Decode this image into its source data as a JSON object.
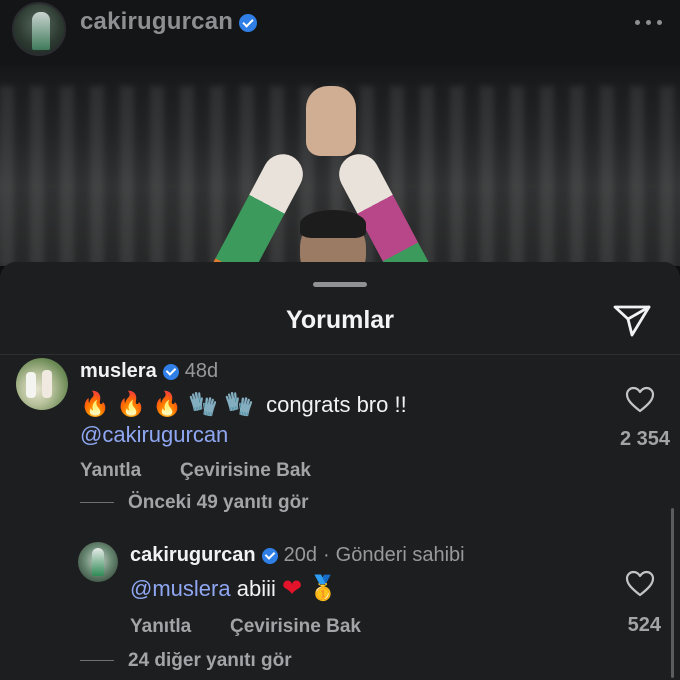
{
  "header": {
    "username": "cakirugurcan",
    "verified": true,
    "more_icon": "more-horizontal-icon"
  },
  "sheet": {
    "title": "Yorumlar",
    "share_icon": "send-icon"
  },
  "comments": [
    {
      "username": "muslera",
      "verified": true,
      "age": "48d",
      "text_emojis": "🔥 🔥 🔥 🧤 🧤",
      "text": "congrats bro !!",
      "mention": "@cakirugurcan",
      "reply_label": "Yanıtla",
      "translate_label": "Çevirisine Bak",
      "like_count": "2 354",
      "view_replies": "Önceki 49 yanıtı gör",
      "replies": [
        {
          "username": "cakirugurcan",
          "verified": true,
          "age": "20d",
          "author_tag": "Gönderi sahibi",
          "mention": "@muslera",
          "text": "abiii",
          "emojis": [
            "❤",
            "🥇"
          ],
          "reply_label": "Yanıtla",
          "translate_label": "Çevirisine Bak",
          "like_count": "524"
        }
      ],
      "view_more_replies": "24 diğer yanıtı gör"
    }
  ],
  "colors": {
    "background": "#1d1e20",
    "mention": "#8fa7f2",
    "verified": "#2f7fe6",
    "muted_text": "#a3a4a7"
  }
}
